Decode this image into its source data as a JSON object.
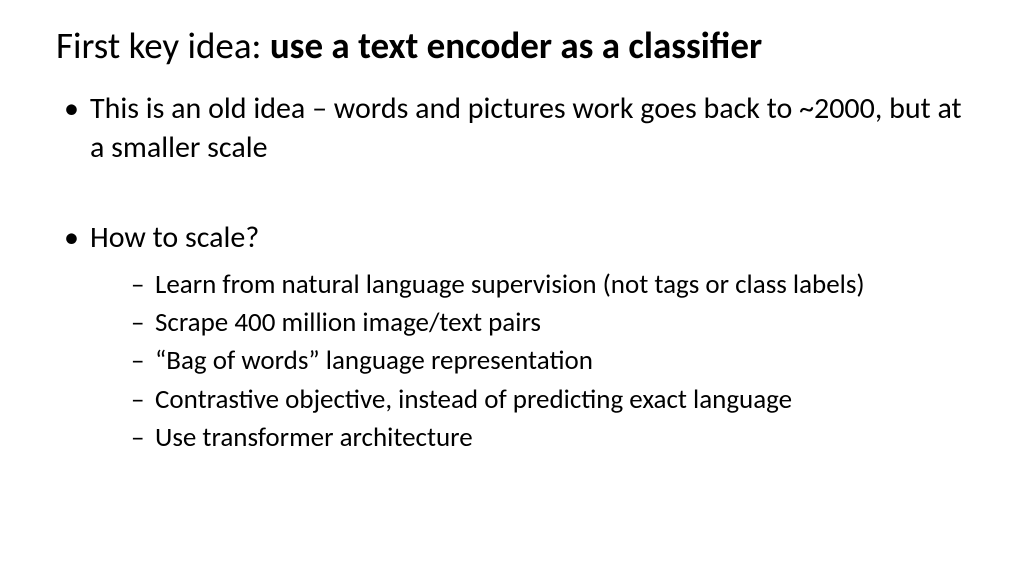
{
  "title": {
    "prefix": "First key idea: ",
    "bold": "use a text encoder as a classifier"
  },
  "bullets": [
    {
      "text": "This is an old idea – words and pictures work goes back to ~2000, but at a smaller scale",
      "subs": []
    },
    {
      "text": "How to scale?",
      "subs": [
        "Learn from natural language supervision (not tags or class labels)",
        "Scrape 400 million image/text pairs",
        "“Bag of words” language representation",
        "Contrastive objective, instead of predicting exact language",
        "Use transformer architecture"
      ]
    }
  ]
}
